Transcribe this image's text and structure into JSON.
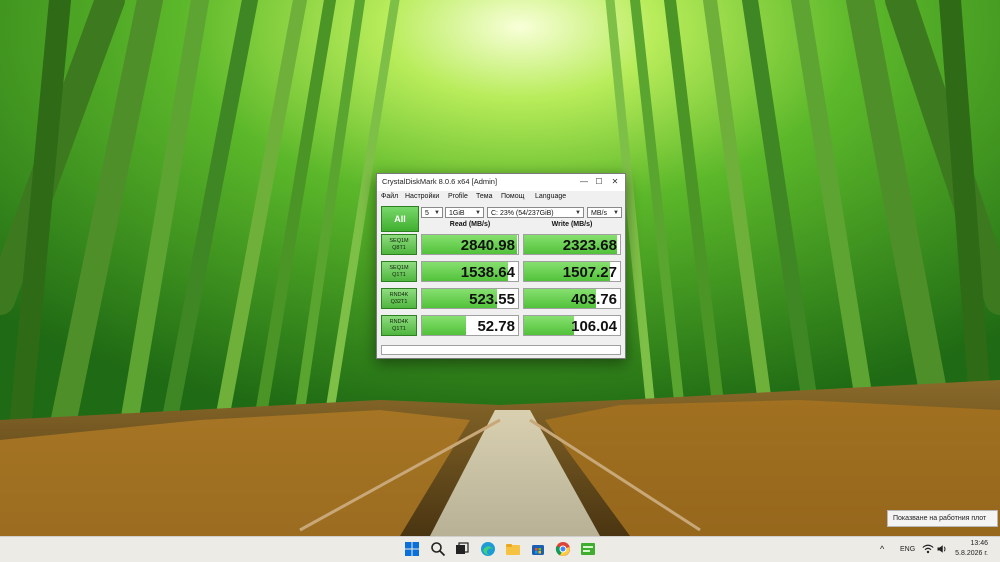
{
  "window": {
    "title": "CrystalDiskMark 8.0.6 x64 [Admin]",
    "controls": {
      "minimize": "—",
      "maximize": "☐",
      "close": "✕"
    }
  },
  "menu": [
    "Файл",
    "Настройки",
    "Profile",
    "Тема",
    "Помощ",
    "Language"
  ],
  "controls": {
    "all_button": "All",
    "count": "5",
    "size": "1GiB",
    "drive": "C: 23% (54/237GiB)",
    "unit": "MB/s"
  },
  "headers": {
    "read": "Read (MB/s)",
    "write": "Write (MB/s)"
  },
  "tests": [
    {
      "line1": "SEQ1M",
      "line2": "Q8T1",
      "read": "2840.98",
      "write": "2323.68",
      "read_fill": 0.99,
      "write_fill": 0.97
    },
    {
      "line1": "SEQ1M",
      "line2": "Q1T1",
      "read": "1538.64",
      "write": "1507.27",
      "read_fill": 0.9,
      "write_fill": 0.9
    },
    {
      "line1": "RND4K",
      "line2": "Q32T1",
      "read": "523.55",
      "write": "403.76",
      "read_fill": 0.78,
      "write_fill": 0.75
    },
    {
      "line1": "RND4K",
      "line2": "Q1T1",
      "read": "52.78",
      "write": "106.04",
      "read_fill": 0.46,
      "write_fill": 0.52
    }
  ],
  "tooltip": "Показване на работния плот",
  "taskbar": {
    "icons": [
      "windows-start-icon",
      "search-icon",
      "task-view-icon",
      "edge-icon",
      "file-explorer-icon",
      "store-icon",
      "chrome-icon",
      "crystaldiskmark-icon"
    ],
    "language": "ENG",
    "time": "13:46",
    "date": "5.8.2026 г."
  }
}
